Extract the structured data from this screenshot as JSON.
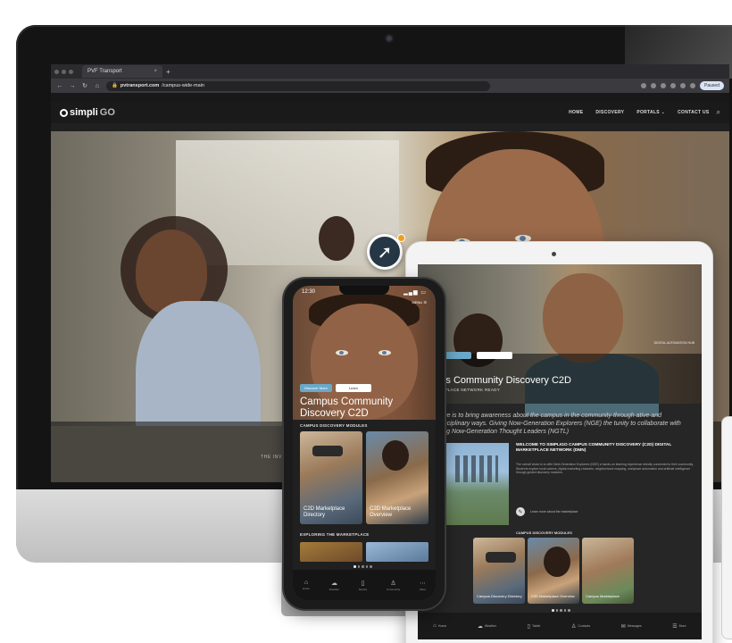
{
  "browser": {
    "tab_title": "PVF Transport",
    "tab_close": "×",
    "new_tab": "+",
    "back": "←",
    "forward": "→",
    "reload": "↻",
    "home": "⌂",
    "url_domain": "pvtransport.com",
    "url_path": "/campus-wide-main",
    "profile_label": "Paused"
  },
  "site": {
    "logo_text": "simpli",
    "logo_suffix": "GO",
    "nav": [
      "HOME",
      "DISCOVERY",
      "PORTALS ⌄",
      "CONTACT US"
    ],
    "search_icon": "⌕",
    "hero_caption": "THE INV"
  },
  "fab": {
    "icon": "➚"
  },
  "tablet": {
    "btn_primary": "",
    "btn_secondary": "",
    "tag": "DIGITAL AUTOMATION HUB",
    "title": "mpus Community Discovery C2D",
    "subtitle": "MARKETPLACE NETWORK READY",
    "quote": "hallenge is to bring awareness about the campus in the community through ative and interdisciplinary ways. Giving Now-Generation Explorers (NGE) the tunity to collaborate with inspiring Now-Generation Thought Leaders (NGTL)",
    "welcome": "WELCOME TO SIMPLIGO CAMPUS COMMUNITY DISCOVERY (C2D) DIGITAL MARKETPLACE NETWORK (DMN)",
    "body": "The overall vision is to offer Next-Generation Explorers (NGE) a hands-on learning experience directly connected to their community. Students explore local careers, digital marketing channels, neighborhood mapping, workplace automation and artificial intelligence through guided discovery modules.",
    "learn_icon": "✎",
    "learn_text": "Learn more about the marketplace",
    "modules_heading": "CAMPUS DISCOVERY MODULES",
    "cards": [
      "Campus Discovery Directory",
      "C2D Marketplace Overview",
      "Campus Marketplace"
    ],
    "tabs": [
      {
        "icon": "⌂",
        "label": "Home"
      },
      {
        "icon": "☁",
        "label": "Weather"
      },
      {
        "icon": "▯",
        "label": "Tablet"
      },
      {
        "icon": "♙",
        "label": "Contacts"
      },
      {
        "icon": "✉",
        "label": "Messages"
      },
      {
        "icon": "☰",
        "label": "More"
      }
    ]
  },
  "phone": {
    "time": "12:30",
    "signal": "▂▄▆ ▭",
    "menu": "MENU ☰",
    "btn_primary": "Discover More",
    "btn_secondary": "Learn",
    "title": "Campus Community Discovery C2D",
    "section_modules": "CAMPUS DISCOVERY MODULES",
    "cards": [
      "C2D Marketplace Directory",
      "C2D Marketplace Overview"
    ],
    "section_exploring": "EXPLORING THE MARKETPLACE",
    "tabs": [
      {
        "icon": "⌂",
        "label": "Home"
      },
      {
        "icon": "☁",
        "label": "Weather"
      },
      {
        "icon": "▯",
        "label": "Device"
      },
      {
        "icon": "♙",
        "label": "Community"
      },
      {
        "icon": "⋯",
        "label": "More"
      }
    ]
  }
}
